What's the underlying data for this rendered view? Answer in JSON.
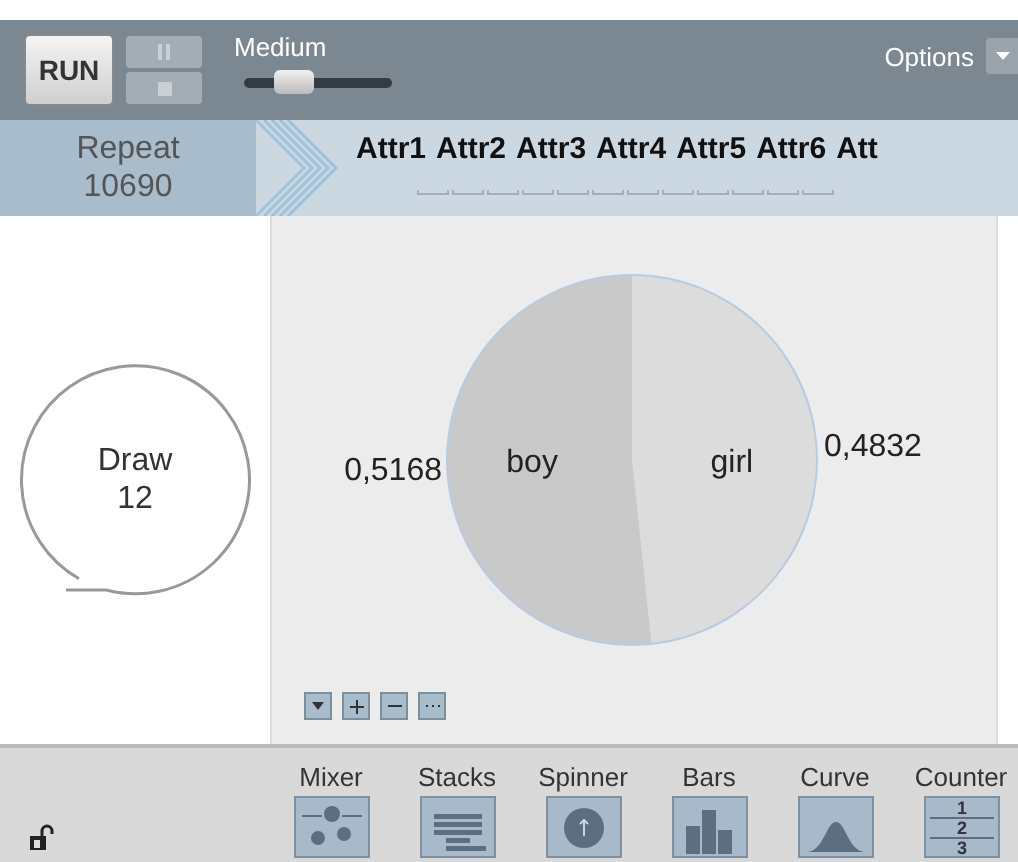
{
  "toolbar": {
    "run_label": "RUN",
    "speed": {
      "label": "Medium",
      "level": 0.34
    },
    "options_label": "Options"
  },
  "header": {
    "repeat_label": "Repeat",
    "repeat_count": "10690",
    "attributes": [
      "Attr1",
      "Attr2",
      "Attr3",
      "Attr4",
      "Attr5",
      "Attr6",
      "Att"
    ]
  },
  "draw": {
    "label": "Draw",
    "count": "12"
  },
  "chart": {
    "chart_data": {
      "type": "pie",
      "categories": [
        "boy",
        "girl"
      ],
      "values": [
        0.5168,
        0.4832
      ],
      "value_labels": [
        "0,5168",
        "0,4832"
      ]
    }
  },
  "palette": {
    "locked": false,
    "tools": [
      {
        "kind": "mixer",
        "label": "Mixer"
      },
      {
        "kind": "stacks",
        "label": "Stacks"
      },
      {
        "kind": "spinner",
        "label": "Spinner"
      },
      {
        "kind": "bars",
        "label": "Bars"
      },
      {
        "kind": "curve",
        "label": "Curve"
      },
      {
        "kind": "counter",
        "label": "Counter",
        "digits": [
          "1",
          "2",
          "3"
        ]
      }
    ]
  }
}
